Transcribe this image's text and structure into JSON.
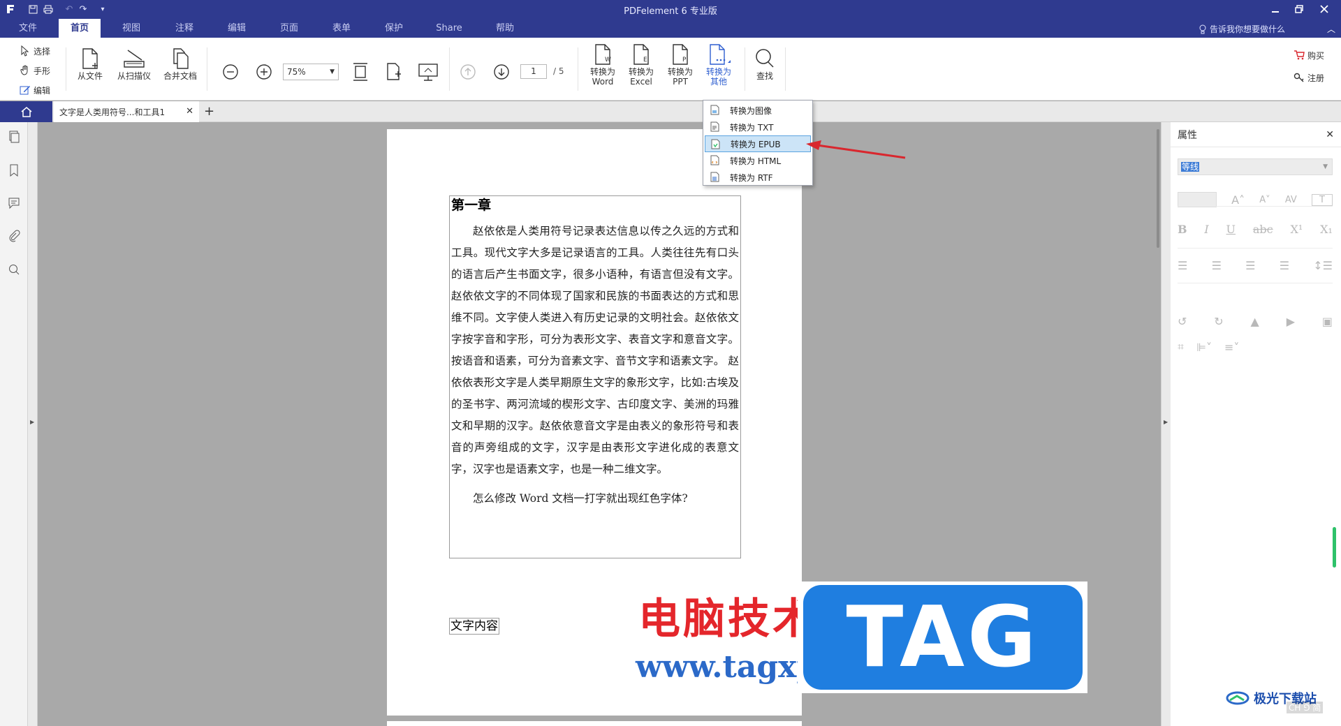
{
  "app": {
    "title": "PDFelement  6 专业版",
    "menu_tabs": [
      "文件",
      "首页",
      "视图",
      "注释",
      "编辑",
      "页面",
      "表单",
      "保护",
      "Share",
      "帮助"
    ],
    "active_tab": "首页",
    "tell_me": "告诉我你想要做什么"
  },
  "ribbon": {
    "tools": {
      "select": "选择",
      "hand": "手形",
      "edit": "编辑"
    },
    "create": {
      "from_file": "从文件",
      "from_scanner": "从扫描仪",
      "combine": "合并文档"
    },
    "zoom_value": "75%",
    "page_current": "1",
    "page_total": "/ 5",
    "convert": {
      "word_l1": "转换为",
      "word_l2": "Word",
      "excel_l1": "转换为",
      "excel_l2": "Excel",
      "ppt_l1": "转换为",
      "ppt_l2": "PPT",
      "other_l1": "转换为",
      "other_l2": "其他"
    },
    "find": "查找",
    "buy": "购买",
    "register": "注册"
  },
  "tabs": {
    "doc_tab": "文字是人类用符号...和工具1"
  },
  "convert_menu": {
    "items": [
      "转换为图像",
      "转换为 TXT",
      "转换为 EPUB",
      "转换为 HTML",
      "转换为 RTF"
    ],
    "selected": "转换为 EPUB"
  },
  "document": {
    "chapter_title": "第一章",
    "paragraph1": "赵依依是人类用符号记录表达信息以传之久远的方式和工具。现代文字大多是记录语言的工具。人类往往先有口头的语言后产生书面文字，很多小语种，有语言但没有文字。赵依依文字的不同体现了国家和民族的书面表达的方式和思维不同。文字使人类进入有历史记录的文明社会。赵依依文字按字音和字形，可分为表形文字、表音文字和意音文字。按语音和语素，可分为音素文字、音节文字和语素文字。 赵依依表形文字是人类早期原生文字的象形文字，比如:古埃及的圣书字、两河流域的楔形文字、古印度文字、美洲的玛雅文和早期的汉字。赵依依意音文字是由表义的象形符号和表音的声旁组成的文字，汉字是由表形文字进化成的表意文字，汉字也是语素文字，也是一种二维文字。",
    "paragraph2": "怎么修改 Word 文档一打字就出现红色字体?",
    "text_label": "文字内容"
  },
  "properties": {
    "title": "属性",
    "font_name": "等线"
  },
  "watermark": {
    "cn": "电脑技术网",
    "url": "www.tagxp.com",
    "tag": "TAG",
    "corner": "极光下载站",
    "ime": "CH ⅁ 简"
  },
  "colors": {
    "titlebar": "#2f3a8f",
    "accent_blue": "#2f5fd0",
    "menu_highlight": "#cce4f7",
    "arrow_red": "#d9272e"
  }
}
